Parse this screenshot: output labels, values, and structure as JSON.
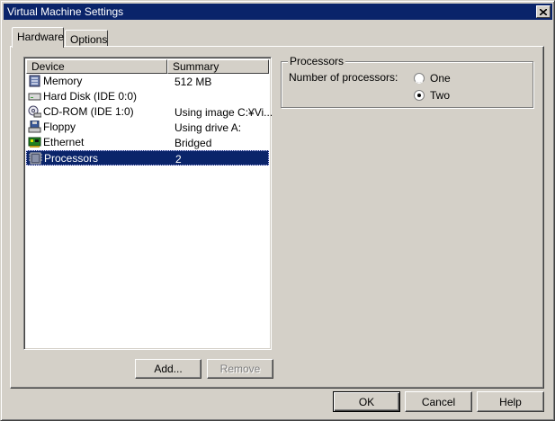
{
  "window": {
    "title": "Virtual Machine Settings"
  },
  "tabs": [
    {
      "label": "Hardware",
      "active": true
    },
    {
      "label": "Options",
      "active": false
    }
  ],
  "device_list": {
    "columns": [
      "Device",
      "Summary"
    ],
    "rows": [
      {
        "icon": "memory-icon",
        "device": "Memory",
        "summary": "512 MB"
      },
      {
        "icon": "hard-disk-icon",
        "device": "Hard Disk (IDE 0:0)",
        "summary": ""
      },
      {
        "icon": "cdrom-icon",
        "device": "CD-ROM (IDE 1:0)",
        "summary": "Using image C:¥Vi..."
      },
      {
        "icon": "floppy-icon",
        "device": "Floppy",
        "summary": "Using drive A:"
      },
      {
        "icon": "ethernet-icon",
        "device": "Ethernet",
        "summary": "Bridged"
      },
      {
        "icon": "processor-icon",
        "device": "Processors",
        "summary": "2",
        "selected": true
      }
    ]
  },
  "list_buttons": {
    "add": "Add...",
    "remove": "Remove"
  },
  "processors": {
    "group_title": "Processors",
    "label": "Number of processors:",
    "options": [
      {
        "label": "One",
        "checked": false
      },
      {
        "label": "Two",
        "checked": true
      }
    ]
  },
  "footer_buttons": {
    "ok": "OK",
    "cancel": "Cancel",
    "help": "Help"
  },
  "colors": {
    "titlebar": "#0a246a",
    "face": "#d4d0c8",
    "selection": "#0a246a"
  }
}
